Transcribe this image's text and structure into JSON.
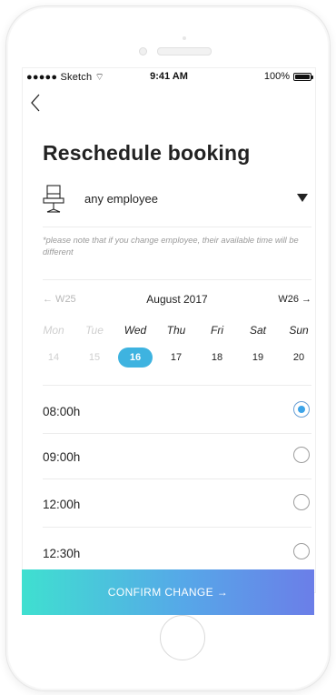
{
  "status_bar": {
    "carrier": "●●●●● Sketch ⌔",
    "time": "9:41 AM",
    "battery": "100%"
  },
  "page": {
    "title": "Reschedule booking"
  },
  "employee": {
    "selected": "any employee",
    "icon": "chair-icon"
  },
  "note": "*please note that if you change employee, their available time will be different",
  "week_nav": {
    "prev_label": "← W25",
    "month": "August 2017",
    "next_label": "W26 →"
  },
  "days": [
    {
      "name": "Mon",
      "date": "14",
      "state": "past"
    },
    {
      "name": "Tue",
      "date": "15",
      "state": "past"
    },
    {
      "name": "Wed",
      "date": "16",
      "state": "selected"
    },
    {
      "name": "Thu",
      "date": "17",
      "state": "active"
    },
    {
      "name": "Fri",
      "date": "18",
      "state": "active"
    },
    {
      "name": "Sat",
      "date": "19",
      "state": "active"
    },
    {
      "name": "Sun",
      "date": "20",
      "state": "active"
    }
  ],
  "time_slots": [
    {
      "label": "08:00h",
      "selected": true
    },
    {
      "label": "09:00h",
      "selected": false
    },
    {
      "label": "12:00h",
      "selected": false
    },
    {
      "label": "12:30h",
      "selected": false
    }
  ],
  "confirm": {
    "label": "CONFIRM CHANGE →"
  },
  "colors": {
    "accent": "#3eb3e0",
    "gradient_start": "#3fe0d0",
    "gradient_end": "#6b7ee8"
  }
}
